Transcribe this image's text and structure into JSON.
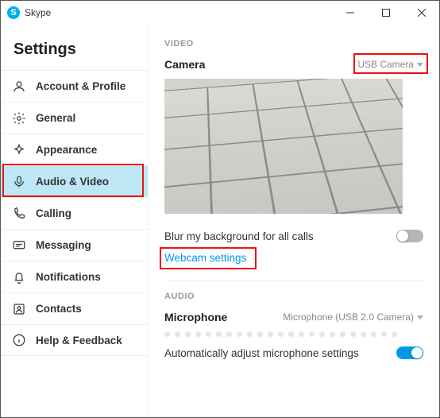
{
  "titlebar": {
    "app_name": "Skype"
  },
  "sidebar": {
    "title": "Settings",
    "items": [
      {
        "label": "Account & Profile",
        "icon": "person-icon"
      },
      {
        "label": "General",
        "icon": "gear-icon"
      },
      {
        "label": "Appearance",
        "icon": "sparkle-icon"
      },
      {
        "label": "Audio & Video",
        "icon": "microphone-icon",
        "active": true
      },
      {
        "label": "Calling",
        "icon": "phone-icon"
      },
      {
        "label": "Messaging",
        "icon": "message-icon"
      },
      {
        "label": "Notifications",
        "icon": "bell-icon"
      },
      {
        "label": "Contacts",
        "icon": "contacts-icon"
      },
      {
        "label": "Help & Feedback",
        "icon": "info-icon"
      }
    ]
  },
  "video": {
    "section_label": "VIDEO",
    "camera_label": "Camera",
    "camera_selected": "USB Camera",
    "blur_label": "Blur my background for all calls",
    "blur_enabled": false,
    "webcam_settings_link": "Webcam settings"
  },
  "audio": {
    "section_label": "AUDIO",
    "mic_label": "Microphone",
    "mic_selected": "Microphone (USB 2.0 Camera)",
    "auto_adjust_label": "Automatically adjust microphone settings",
    "auto_adjust_enabled": true
  }
}
